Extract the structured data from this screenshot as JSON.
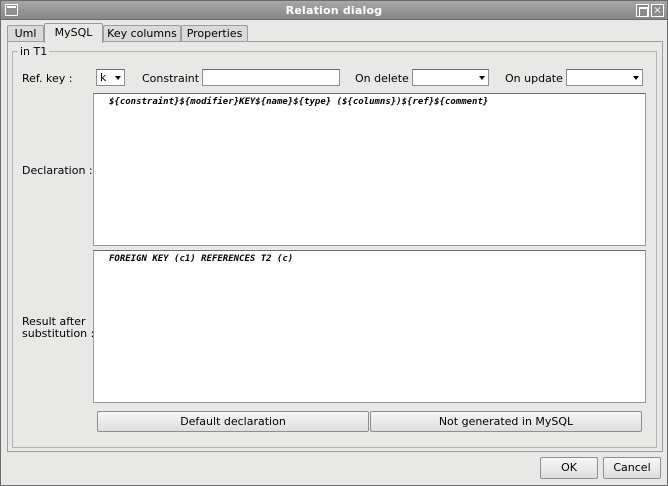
{
  "window": {
    "title": "Relation dialog",
    "close_symbol": "×"
  },
  "tabs": [
    {
      "label": "Uml"
    },
    {
      "label": "MySQL"
    },
    {
      "label": "Key columns"
    },
    {
      "label": "Properties"
    }
  ],
  "active_tab": "MySQL",
  "group": {
    "title": "in T1"
  },
  "fields": {
    "ref_key_label": "Ref. key :",
    "ref_key_value": "k",
    "constraint_label": "Constraint :",
    "constraint_value": "",
    "on_delete_label": "On delete :",
    "on_delete_value": "",
    "on_update_label": "On update :",
    "on_update_value": ""
  },
  "declaration": {
    "label": "Declaration :",
    "value": "${constraint}${modifier}KEY${name}${type} (${columns})${ref}${comment}"
  },
  "result": {
    "label_line1": "Result after",
    "label_line2": "substitution :",
    "value": "FOREIGN KEY (c1) REFERENCES T2 (c)"
  },
  "buttons": {
    "default_declaration": "Default declaration",
    "not_generated": "Not generated in MySQL",
    "ok": "OK",
    "cancel": "Cancel"
  },
  "icons": {
    "window_icon": "window-menu-icon",
    "maximize": "maximize-icon",
    "close": "close-icon",
    "dropdown": "chevron-down-icon"
  }
}
